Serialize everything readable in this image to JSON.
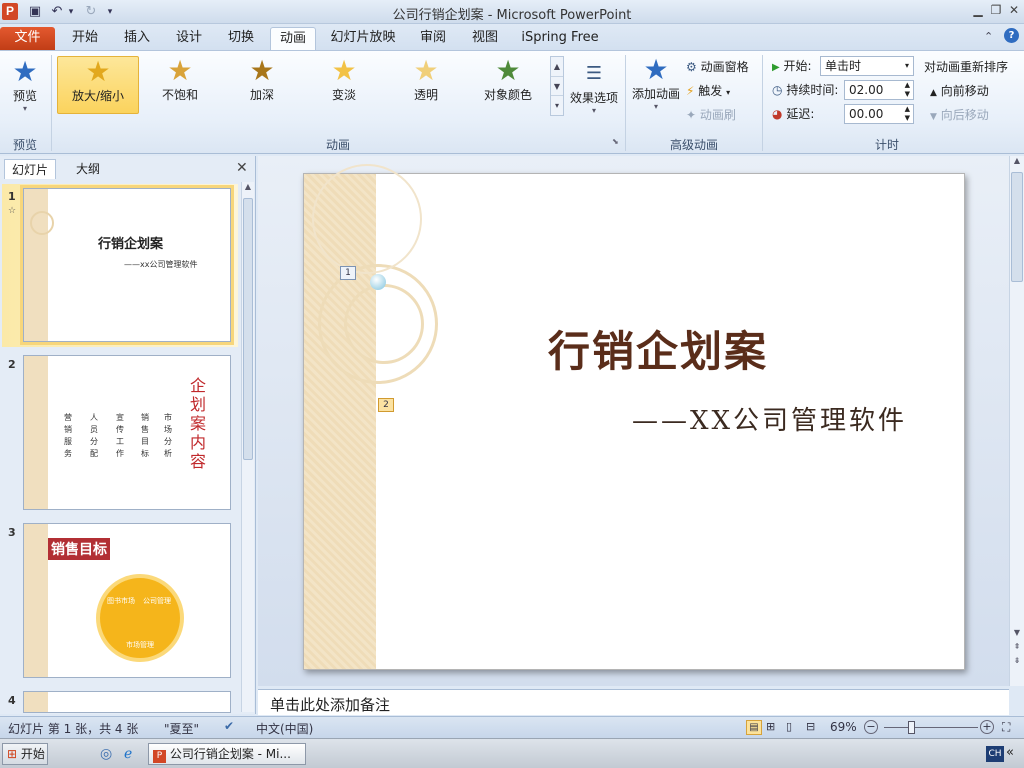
{
  "window": {
    "title": "公司行销企划案 - Microsoft PowerPoint",
    "app_icon_letter": "P"
  },
  "tabs": [
    {
      "label": "文件"
    },
    {
      "label": "开始"
    },
    {
      "label": "插入"
    },
    {
      "label": "设计"
    },
    {
      "label": "切换"
    },
    {
      "label": "动画"
    },
    {
      "label": "幻灯片放映"
    },
    {
      "label": "审阅"
    },
    {
      "label": "视图"
    },
    {
      "label": "iSpring Free"
    }
  ],
  "active_tab": "动画",
  "ribbon": {
    "preview_group": {
      "button": "预览",
      "label": "预览"
    },
    "animation_group": {
      "label": "动画",
      "gallery": [
        "放大/缩小",
        "不饱和",
        "加深",
        "变淡",
        "透明",
        "对象颜色"
      ],
      "selected": "放大/缩小",
      "effect_options": "效果选项"
    },
    "advanced_group": {
      "label": "高级动画",
      "add_animation": "添加动画",
      "animation_pane": "动画窗格",
      "trigger": "触发",
      "painter": "动画刷"
    },
    "timing_group": {
      "label": "计时",
      "start_label": "开始:",
      "start_value": "单击时",
      "duration_label": "持续时间:",
      "duration_value": "02.00",
      "delay_label": "延迟:",
      "delay_value": "00.00",
      "reorder_title": "对动画重新排序",
      "move_earlier": "向前移动",
      "move_later": "向后移动"
    }
  },
  "left_pane": {
    "tab_slides": "幻灯片",
    "tab_outline": "大纲",
    "slides": [
      {
        "num": "1",
        "title": "行销企划案",
        "subtitle": "——xx公司管理软件"
      },
      {
        "num": "2",
        "title": "企划案内容",
        "items": [
          "营销服务",
          "人员分配",
          "宣传工作",
          "销售目标",
          "市场分析"
        ]
      },
      {
        "num": "3",
        "title": "销售目标",
        "segments": [
          "图书市场",
          "公司管理",
          "市场管理"
        ]
      },
      {
        "num": "4"
      }
    ]
  },
  "slide": {
    "title": "行销企划案",
    "subtitle": "——XX公司管理软件",
    "marker1": "1",
    "marker2": "2"
  },
  "notes_placeholder": "单击此处添加备注",
  "status": {
    "slide_info": "幻灯片 第 1 张，共 4 张",
    "theme": "\"夏至\"",
    "language": "中文(中国)",
    "zoom": "69%"
  },
  "taskbar": {
    "start": "开始",
    "task": "公司行销企划案 - Mi...",
    "ime": "CH"
  },
  "colors": {
    "file_tab": "#d24726",
    "slide_title": "#5a2d1a",
    "thumb_red": "#c0282b",
    "pie_orange": "#f5b51b"
  }
}
